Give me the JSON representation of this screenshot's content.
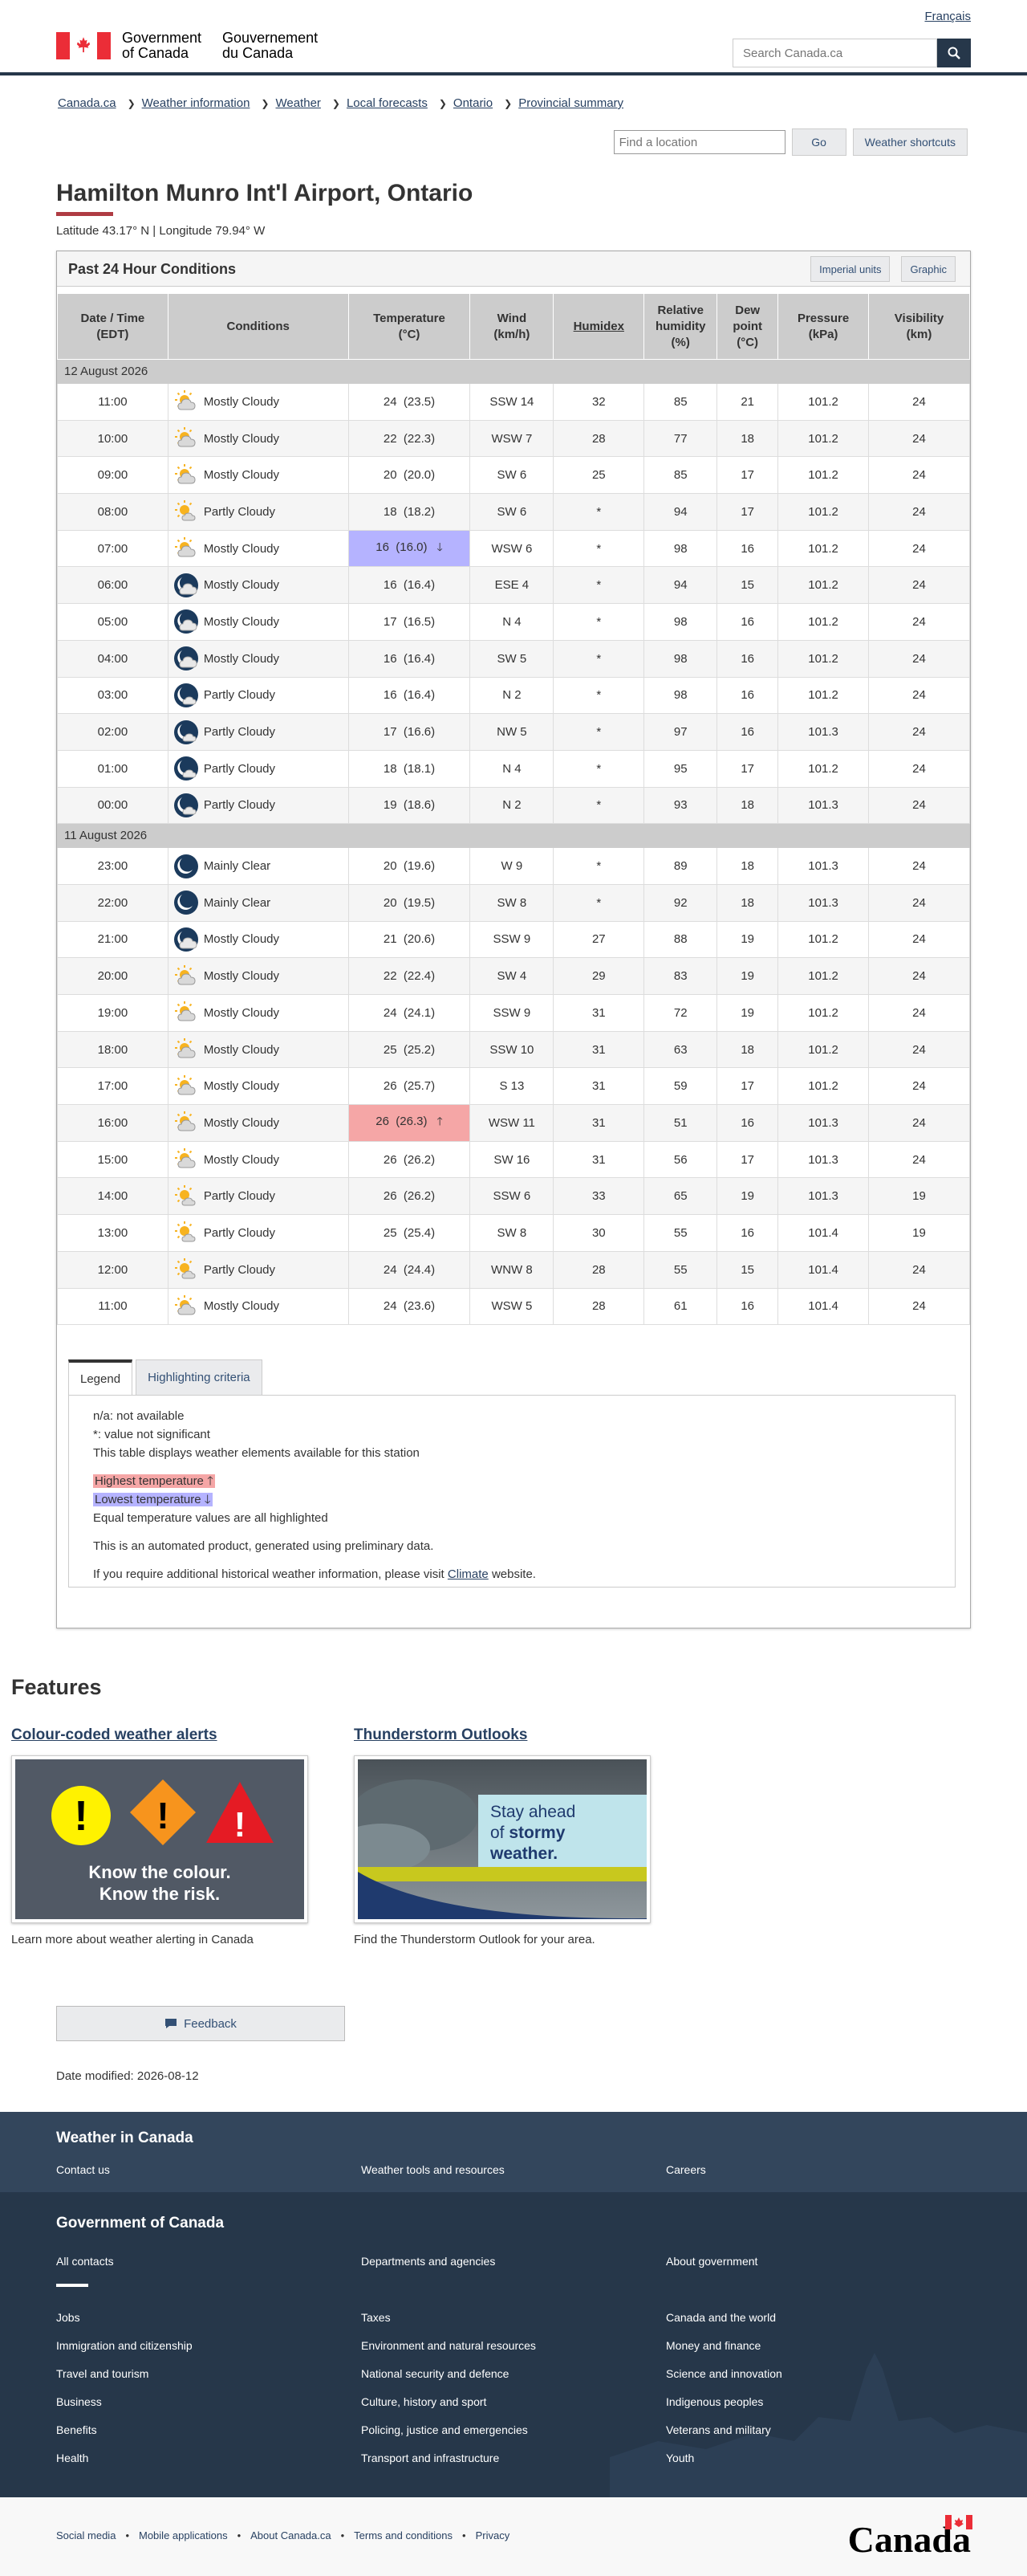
{
  "header": {
    "lang_toggle": "Français",
    "goc_en_line1": "Government",
    "goc_en_line2": "of Canada",
    "goc_fr_line1": "Gouvernement",
    "goc_fr_line2": "du Canada",
    "search_placeholder": "Search Canada.ca"
  },
  "breadcrumb": [
    "Canada.ca",
    "Weather information",
    "Weather",
    "Local forecasts",
    "Ontario",
    "Provincial summary"
  ],
  "location_tools": {
    "find_placeholder": "Find a location",
    "go_label": "Go",
    "shortcuts_label": "Weather shortcuts"
  },
  "page": {
    "title": "Hamilton Munro Int'l Airport, Ontario",
    "latlon": "Latitude 43.17° N | Longitude 79.94° W"
  },
  "panel": {
    "title": "Past 24 Hour Conditions",
    "imperial_label": "Imperial units",
    "graphic_label": "Graphic"
  },
  "table": {
    "headers": {
      "time": [
        "Date / Time",
        "(EDT)"
      ],
      "conditions": "Conditions",
      "temp": [
        "Temperature",
        "(°C)"
      ],
      "wind": [
        "Wind",
        "(km/h)"
      ],
      "humidex": "Humidex",
      "rh": [
        "Relative",
        "humidity",
        "(%)"
      ],
      "dew": [
        "Dew",
        "point",
        "(°C)"
      ],
      "pressure": [
        "Pressure",
        "(kPa)"
      ],
      "visibility": [
        "Visibility",
        "(km)"
      ]
    },
    "groups": [
      {
        "date": "12 August 2026",
        "rows": [
          {
            "time": "11:00",
            "icon": "sun-cloud-icon",
            "cond": "Mostly Cloudy",
            "temp": "24",
            "tempx": "(23.5)",
            "wind": "SSW 14",
            "humidex": "32",
            "rh": "85",
            "dew": "21",
            "pres": "101.2",
            "vis": "24",
            "mark": ""
          },
          {
            "time": "10:00",
            "icon": "sun-cloud-icon",
            "cond": "Mostly Cloudy",
            "temp": "22",
            "tempx": "(22.3)",
            "wind": "WSW 7",
            "humidex": "28",
            "rh": "77",
            "dew": "18",
            "pres": "101.2",
            "vis": "24",
            "mark": ""
          },
          {
            "time": "09:00",
            "icon": "sun-cloud-icon",
            "cond": "Mostly Cloudy",
            "temp": "20",
            "tempx": "(20.0)",
            "wind": "SW 6",
            "humidex": "25",
            "rh": "85",
            "dew": "17",
            "pres": "101.2",
            "vis": "24",
            "mark": ""
          },
          {
            "time": "08:00",
            "icon": "sun-partial-icon",
            "cond": "Partly Cloudy",
            "temp": "18",
            "tempx": "(18.2)",
            "wind": "SW 6",
            "humidex": "*",
            "rh": "94",
            "dew": "17",
            "pres": "101.2",
            "vis": "24",
            "mark": ""
          },
          {
            "time": "07:00",
            "icon": "sun-cloud-icon",
            "cond": "Mostly Cloudy",
            "temp": "16",
            "tempx": "(16.0)",
            "wind": "WSW 6",
            "humidex": "*",
            "rh": "98",
            "dew": "16",
            "pres": "101.2",
            "vis": "24",
            "mark": "lo"
          },
          {
            "time": "06:00",
            "icon": "moon-cloud-icon",
            "cond": "Mostly Cloudy",
            "temp": "16",
            "tempx": "(16.4)",
            "wind": "ESE 4",
            "humidex": "*",
            "rh": "94",
            "dew": "15",
            "pres": "101.2",
            "vis": "24",
            "mark": ""
          },
          {
            "time": "05:00",
            "icon": "moon-cloud-icon",
            "cond": "Mostly Cloudy",
            "temp": "17",
            "tempx": "(16.5)",
            "wind": "N 4",
            "humidex": "*",
            "rh": "98",
            "dew": "16",
            "pres": "101.2",
            "vis": "24",
            "mark": ""
          },
          {
            "time": "04:00",
            "icon": "moon-cloud-icon",
            "cond": "Mostly Cloudy",
            "temp": "16",
            "tempx": "(16.4)",
            "wind": "SW 5",
            "humidex": "*",
            "rh": "98",
            "dew": "16",
            "pres": "101.2",
            "vis": "24",
            "mark": ""
          },
          {
            "time": "03:00",
            "icon": "moon-partial-icon",
            "cond": "Partly Cloudy",
            "temp": "16",
            "tempx": "(16.4)",
            "wind": "N 2",
            "humidex": "*",
            "rh": "98",
            "dew": "16",
            "pres": "101.2",
            "vis": "24",
            "mark": ""
          },
          {
            "time": "02:00",
            "icon": "moon-partial-icon",
            "cond": "Partly Cloudy",
            "temp": "17",
            "tempx": "(16.6)",
            "wind": "NW 5",
            "humidex": "*",
            "rh": "97",
            "dew": "16",
            "pres": "101.3",
            "vis": "24",
            "mark": ""
          },
          {
            "time": "01:00",
            "icon": "moon-partial-icon",
            "cond": "Partly Cloudy",
            "temp": "18",
            "tempx": "(18.1)",
            "wind": "N 4",
            "humidex": "*",
            "rh": "95",
            "dew": "17",
            "pres": "101.2",
            "vis": "24",
            "mark": ""
          },
          {
            "time": "00:00",
            "icon": "moon-partial-icon",
            "cond": "Partly Cloudy",
            "temp": "19",
            "tempx": "(18.6)",
            "wind": "N 2",
            "humidex": "*",
            "rh": "93",
            "dew": "18",
            "pres": "101.3",
            "vis": "24",
            "mark": ""
          }
        ]
      },
      {
        "date": "11 August 2026",
        "rows": [
          {
            "time": "23:00",
            "icon": "moon-clear-icon",
            "cond": "Mainly Clear",
            "temp": "20",
            "tempx": "(19.6)",
            "wind": "W 9",
            "humidex": "*",
            "rh": "89",
            "dew": "18",
            "pres": "101.3",
            "vis": "24",
            "mark": ""
          },
          {
            "time": "22:00",
            "icon": "moon-clear-icon",
            "cond": "Mainly Clear",
            "temp": "20",
            "tempx": "(19.5)",
            "wind": "SW 8",
            "humidex": "*",
            "rh": "92",
            "dew": "18",
            "pres": "101.3",
            "vis": "24",
            "mark": ""
          },
          {
            "time": "21:00",
            "icon": "moon-cloud-icon",
            "cond": "Mostly Cloudy",
            "temp": "21",
            "tempx": "(20.6)",
            "wind": "SSW 9",
            "humidex": "27",
            "rh": "88",
            "dew": "19",
            "pres": "101.2",
            "vis": "24",
            "mark": ""
          },
          {
            "time": "20:00",
            "icon": "sun-cloud-icon",
            "cond": "Mostly Cloudy",
            "temp": "22",
            "tempx": "(22.4)",
            "wind": "SW 4",
            "humidex": "29",
            "rh": "83",
            "dew": "19",
            "pres": "101.2",
            "vis": "24",
            "mark": ""
          },
          {
            "time": "19:00",
            "icon": "sun-cloud-icon",
            "cond": "Mostly Cloudy",
            "temp": "24",
            "tempx": "(24.1)",
            "wind": "SSW 9",
            "humidex": "31",
            "rh": "72",
            "dew": "19",
            "pres": "101.2",
            "vis": "24",
            "mark": ""
          },
          {
            "time": "18:00",
            "icon": "sun-cloud-icon",
            "cond": "Mostly Cloudy",
            "temp": "25",
            "tempx": "(25.2)",
            "wind": "SSW 10",
            "humidex": "31",
            "rh": "63",
            "dew": "18",
            "pres": "101.2",
            "vis": "24",
            "mark": ""
          },
          {
            "time": "17:00",
            "icon": "sun-cloud-icon",
            "cond": "Mostly Cloudy",
            "temp": "26",
            "tempx": "(25.7)",
            "wind": "S 13",
            "humidex": "31",
            "rh": "59",
            "dew": "17",
            "pres": "101.2",
            "vis": "24",
            "mark": ""
          },
          {
            "time": "16:00",
            "icon": "sun-cloud-icon",
            "cond": "Mostly Cloudy",
            "temp": "26",
            "tempx": "(26.3)",
            "wind": "WSW 11",
            "humidex": "31",
            "rh": "51",
            "dew": "16",
            "pres": "101.3",
            "vis": "24",
            "mark": "hi"
          },
          {
            "time": "15:00",
            "icon": "sun-cloud-icon",
            "cond": "Mostly Cloudy",
            "temp": "26",
            "tempx": "(26.2)",
            "wind": "SW 16",
            "humidex": "31",
            "rh": "56",
            "dew": "17",
            "pres": "101.3",
            "vis": "24",
            "mark": ""
          },
          {
            "time": "14:00",
            "icon": "sun-partial-icon",
            "cond": "Partly Cloudy",
            "temp": "26",
            "tempx": "(26.2)",
            "wind": "SSW 6",
            "humidex": "33",
            "rh": "65",
            "dew": "19",
            "pres": "101.3",
            "vis": "19",
            "mark": ""
          },
          {
            "time": "13:00",
            "icon": "sun-partial-icon",
            "cond": "Partly Cloudy",
            "temp": "25",
            "tempx": "(25.4)",
            "wind": "SW 8",
            "humidex": "30",
            "rh": "55",
            "dew": "16",
            "pres": "101.4",
            "vis": "19",
            "mark": ""
          },
          {
            "time": "12:00",
            "icon": "sun-partial-icon",
            "cond": "Partly Cloudy",
            "temp": "24",
            "tempx": "(24.4)",
            "wind": "WNW 8",
            "humidex": "28",
            "rh": "55",
            "dew": "15",
            "pres": "101.4",
            "vis": "24",
            "mark": ""
          },
          {
            "time": "11:00",
            "icon": "sun-cloud-icon",
            "cond": "Mostly Cloudy",
            "temp": "24",
            "tempx": "(23.6)",
            "wind": "WSW 5",
            "humidex": "28",
            "rh": "61",
            "dew": "16",
            "pres": "101.4",
            "vis": "24",
            "mark": ""
          }
        ]
      }
    ]
  },
  "legend": {
    "tab_legend": "Legend",
    "tab_criteria": "Highlighting criteria",
    "na": "n/a: not available",
    "star": "*: value not significant",
    "table_note": "This table displays weather elements available for this station",
    "highest": "Highest temperature",
    "lowest": "Lowest temperature",
    "equal_note": "Equal temperature values are all highlighted",
    "automated": "This is an automated product, generated using preliminary data.",
    "climate_pre": "If you require additional historical weather information, please visit",
    "climate_link": "Climate",
    "climate_post": "website."
  },
  "features": {
    "title": "Features",
    "items": [
      {
        "title": "Colour-coded weather alerts",
        "img_line1": "Know the colour.",
        "img_line2": "Know the risk.",
        "caption": "Learn more about weather alerting in Canada"
      },
      {
        "title": "Thunderstorm Outlooks",
        "img_line1": "Stay ahead",
        "img_line2_a": "of",
        "img_line2_b": "stormy",
        "img_line3": "weather.",
        "caption": "Find the Thunderstorm Outlook for your area."
      }
    ]
  },
  "feedback_label": "Feedback",
  "date_modified": "Date modified: 2026-08-12",
  "footer": {
    "weather_title": "Weather in Canada",
    "weather_links": [
      "Contact us",
      "Weather tools and resources",
      "Careers"
    ],
    "goc_title": "Government of Canada",
    "goc_top": [
      "All contacts",
      "Departments and agencies",
      "About government"
    ],
    "col1": [
      "Jobs",
      "Immigration and citizenship",
      "Travel and tourism",
      "Business",
      "Benefits",
      "Health"
    ],
    "col2": [
      "Taxes",
      "Environment and natural resources",
      "National security and defence",
      "Culture, history and sport",
      "Policing, justice and emergencies",
      "Transport and infrastructure"
    ],
    "col3": [
      "Canada and the world",
      "Money and finance",
      "Science and innovation",
      "Indigenous peoples",
      "Veterans and military",
      "Youth"
    ],
    "sub_links": [
      "Social media",
      "Mobile applications",
      "About Canada.ca",
      "Terms and conditions",
      "Privacy"
    ],
    "wordmark": "Canada"
  }
}
